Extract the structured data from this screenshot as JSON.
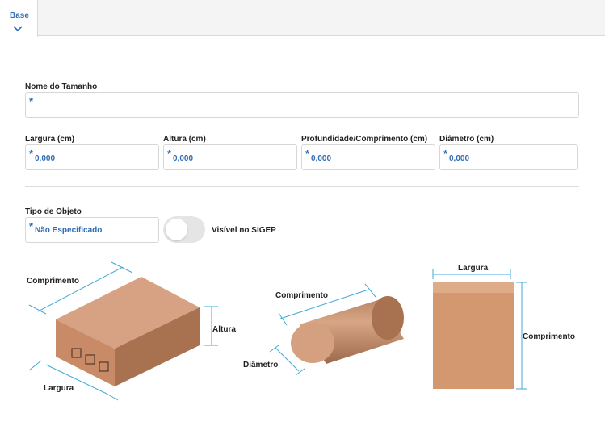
{
  "tabs": [
    {
      "label": "Base",
      "active": true
    }
  ],
  "form": {
    "name": {
      "label": "Nome do Tamanho",
      "value": ""
    },
    "width": {
      "label": "Largura (cm)",
      "value": "0,000"
    },
    "height": {
      "label": "Altura (cm)",
      "value": "0,000"
    },
    "depth": {
      "label": "Profundidade/Comprimento (cm)",
      "value": "0,000"
    },
    "diameter": {
      "label": "Diâmetro (cm)",
      "value": "0,000"
    },
    "object_type": {
      "label": "Tipo de Objeto",
      "value": "Não Especificado"
    },
    "required_marker": "*",
    "sigep_toggle": {
      "label": "Visível no SIGEP",
      "on": false
    }
  },
  "illustrations": {
    "box": {
      "comprimento": "Comprimento",
      "altura": "Altura",
      "largura": "Largura"
    },
    "cylinder": {
      "comprimento": "Comprimento",
      "diametro": "Diâmetro"
    },
    "envelope": {
      "largura": "Largura",
      "comprimento": "Comprimento"
    }
  },
  "colors": {
    "accent": "#2d6db5",
    "dimension_line": "#3fa9d8",
    "box_top": "#d6a283",
    "box_front": "#c98a68",
    "box_side": "#a8714f",
    "envelope": "#d3986f"
  }
}
